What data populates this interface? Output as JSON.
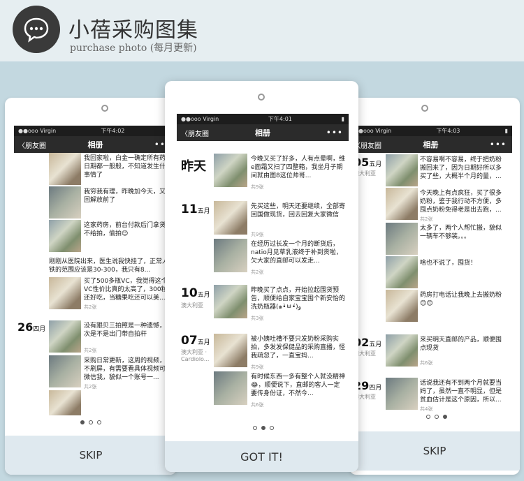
{
  "header": {
    "title": "小蓓采购图集",
    "subtitle": "purchase photo (每月更新)"
  },
  "left": {
    "status": {
      "carrier": "●●ooo Virgin",
      "time": "下午4:02"
    },
    "nav": {
      "back": "〈朋友圈",
      "title": "相册",
      "more": "•••"
    },
    "posts": [
      {
        "text": "我回家啦，白金一确定所有药房日期都一般般，不知道发生什么事情了",
        "count": ""
      },
      {
        "text": "我穷我有理，昨晚加今天，又穷回解放前了",
        "count": ""
      },
      {
        "text": "这家药房，前台付款后门拿货，不给拍，偷拍😊",
        "count": ""
      },
      {
        "text": "刚刚从医院出来，医生说我快挂了，正常人体铁的范围应该是30-300，我只有8...",
        "count": ""
      },
      {
        "text": "买了500多瓶VC，我觉得这个VC性价比真的太高了，300粒，还好吃，当糖果吃还可以美...",
        "count": "共2张"
      },
      {
        "text": "没有跟贝三拍照是一种遗憾，下次是不是出门带自拍杆",
        "count": "共2张"
      },
      {
        "text": "采购日常更新，这周的视频，我不刷屏，有需要看具体视频可以微信我，貌似一个账号一...",
        "count": "共2张"
      }
    ],
    "date": {
      "day": "26",
      "month": "四月"
    },
    "skip": "SKIP"
  },
  "center": {
    "status": {
      "carrier": "●●ooo Virgin",
      "time": "下午4:01"
    },
    "nav": {
      "back": "〈朋友圈",
      "title": "相册",
      "more": "•••"
    },
    "groups": [
      {
        "day": "昨天",
        "month": "",
        "loc": "",
        "posts": [
          {
            "text": "今晚又买了好多，人有点晕啊，维e面霜又扫了四整箱，我坐月子期间就由图8这位帅哥...",
            "count": "共9张"
          }
        ]
      },
      {
        "day": "11",
        "month": "五月",
        "loc": "",
        "posts": [
          {
            "text": "先买这些，明天还要继续，全部寄回国做现货，回去回复大家微信",
            "count": "共9张"
          },
          {
            "text": "在经历过长发一个月的断货后，natio月见草乳液终于补到货啦，欠大家的直邮可以发走...",
            "count": "共2张"
          }
        ]
      },
      {
        "day": "10",
        "month": "五月",
        "loc": "澳大利亚",
        "posts": [
          {
            "text": "昨晚买了点点，开始拉起围货预告，顺便给自家宝宝囤个新安怡的洗奶瓶器(๑•̀ㅂ•́)و",
            "count": "共3张"
          }
        ]
      },
      {
        "day": "07",
        "month": "五月",
        "loc": "澳大利亚 · Cardiolo...",
        "posts": [
          {
            "text": "被小姨吐槽不要只发奶粉采购实拍，多发发保健品的采购直播，怪我疏忽了，一直宝妈...",
            "count": "共9张"
          },
          {
            "text": "有时候东西一多有整个人就没精神😂，顺便说下，直邮的客人一定要传身份证，不然今...",
            "count": "共6张"
          }
        ]
      }
    ],
    "button": "GOT IT!"
  },
  "right": {
    "status": {
      "carrier": "●●ooo Virgin",
      "time": "下午4:03"
    },
    "nav": {
      "back": "〈朋友圈",
      "title": "相册",
      "more": "•••"
    },
    "posts": [
      {
        "text": "不容易啊不容易，终于把奶粉搬回来了，因为日期好所以多买了些，大概半个月的量，...",
        "count": ""
      },
      {
        "text": "今天晚上有点疯狂，买了很多奶粉，鉴于我行动不方便，多囤点奶粉免得老是出去跑，...",
        "count": "共2张"
      },
      {
        "text": "太多了，两个人帮忙搬，貌似一辆车不够装。。。",
        "count": ""
      },
      {
        "text": "啥也不说了，囤货！",
        "count": ""
      },
      {
        "text": "药房打电话让我晚上去搬奶粉😊😊",
        "count": ""
      },
      {
        "text": "来买明天直邮的产品，顺便囤点现货",
        "count": "共6张"
      },
      {
        "text": "话说我还有不到两个月就要当妈了，虽然一直不明显，但是贫血估计是这个原因，所以...",
        "count": "共4张"
      }
    ],
    "dates": [
      {
        "day": "05",
        "month": "五月",
        "loc": "澳大利亚"
      },
      {
        "day": "02",
        "month": "五月",
        "loc": "澳大利亚"
      },
      {
        "day": "29",
        "month": "四月",
        "loc": "澳大利亚"
      }
    ],
    "skip": "SKIP"
  }
}
